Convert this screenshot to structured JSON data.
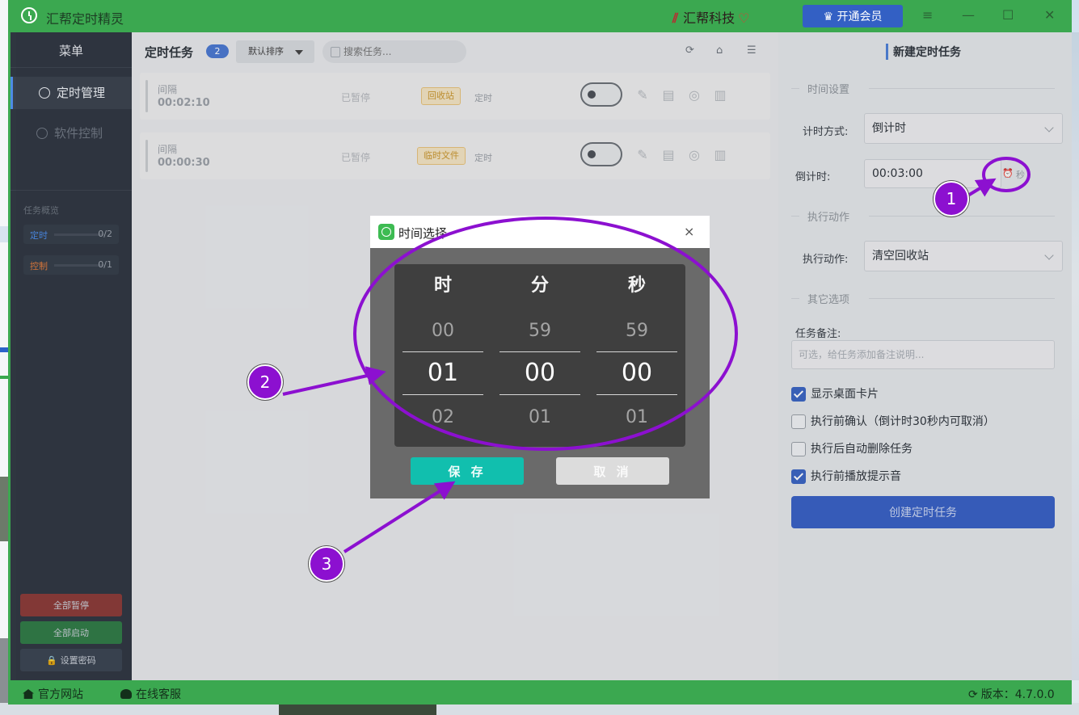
{
  "app": {
    "title": "汇帮定时精灵",
    "brand": "汇帮科技",
    "vip_label": "开通会员",
    "controls": {
      "menu": "≡",
      "minimize": "—",
      "maximize": "☐",
      "close": "✕"
    }
  },
  "sidebar": {
    "title": "菜单",
    "items": [
      {
        "label": "定时管理",
        "active": true
      },
      {
        "label": "软件控制",
        "active": false
      }
    ],
    "overview": {
      "title": "任务概览",
      "rows": [
        {
          "label": "定时",
          "count": "0/2",
          "color": "#4a8be8"
        },
        {
          "label": "控制",
          "count": "0/1",
          "color": "#e07a3a"
        }
      ]
    },
    "buttons": {
      "pause_all": "全部暂停",
      "start_all": "全部启动",
      "set_password": "🔒 设置密码"
    }
  },
  "main": {
    "title": "定时任务",
    "count": "2",
    "sort_label": "默认排序",
    "search_placeholder": "搜索任务...",
    "tasks": [
      {
        "type": "间隔",
        "time": "00:02:10",
        "state": "已暂停",
        "tag": "回收站",
        "mode": "定时"
      },
      {
        "type": "间隔",
        "time": "00:00:30",
        "state": "已暂停",
        "tag": "临时文件",
        "mode": "定时"
      }
    ]
  },
  "right_panel": {
    "title": "新建定时任务",
    "sections": {
      "time": "时间设置",
      "action": "执行动作",
      "other": "其它选项"
    },
    "timing_mode_label": "计时方式:",
    "timing_mode_value": "倒计时",
    "countdown_label": "倒计时:",
    "countdown_value": "00:03:00",
    "countdown_unit": "秒",
    "action_label": "执行动作:",
    "action_value": "清空回收站",
    "remark_label": "任务备注:",
    "remark_placeholder": "可选，给任务添加备注说明...",
    "checkboxes": [
      {
        "label": "显示桌面卡片",
        "checked": true
      },
      {
        "label": "执行前确认（倒计时30秒内可取消）",
        "checked": false
      },
      {
        "label": "执行后自动删除任务",
        "checked": false
      },
      {
        "label": "执行前播放提示音",
        "checked": true
      }
    ],
    "create_button": "创建定时任务"
  },
  "status_bar": {
    "website": "官方网站",
    "support": "在线客服",
    "version": "版本：4.7.0.0"
  },
  "dialog": {
    "title": "时间选择",
    "close": "×",
    "columns": [
      {
        "header": "时",
        "prev": "00",
        "selected": "01",
        "next": "02"
      },
      {
        "header": "分",
        "prev": "59",
        "selected": "00",
        "next": "01"
      },
      {
        "header": "秒",
        "prev": "59",
        "selected": "00",
        "next": "01"
      }
    ],
    "save_label": "保 存",
    "cancel_label": "取 消"
  },
  "annotations": {
    "color": "#8c10d0",
    "markers": [
      "1",
      "2",
      "3"
    ]
  }
}
